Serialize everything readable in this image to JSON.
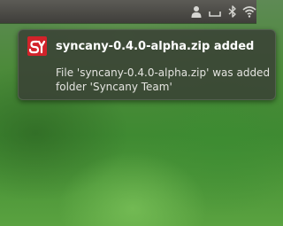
{
  "panel": {
    "icons": [
      "user-icon",
      "keyboard-icon",
      "bluetooth-icon",
      "wifi-icon"
    ]
  },
  "notification": {
    "app_icon": "syncany-logo-icon",
    "title": "syncany-0.4.0-alpha.zip added",
    "body_line1": "File 'syncany-0.4.0-alpha.zip' was added",
    "body_line2": "folder 'Syncany Team'"
  },
  "colors": {
    "panel": "#4a4945",
    "notification_bg": "#3a4236",
    "logo_red": "#d2232a"
  }
}
